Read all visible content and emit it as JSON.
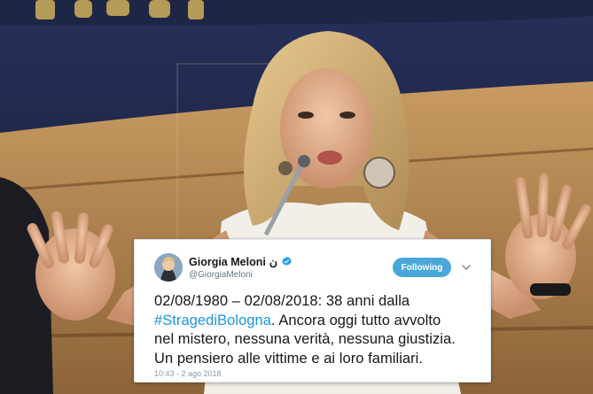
{
  "tweet": {
    "display_name": "Giorgia Meloni",
    "name_glyph": "ن",
    "handle": "@GiorgiaMeloni",
    "follow_label": "Following",
    "text": {
      "line1": "02/08/1980 – 02/08/2018: 38 anni dalla",
      "hashtag": "#StragediBologna",
      "line2_rest": ". Ancora oggi tutto avvolto",
      "line3": "nel mistero, nessuna verità, nessuna giustizia.",
      "line4": "Un pensiero alle vittime e ai loro familiari."
    },
    "timestamp": "10:43 - 2 ago 2018"
  },
  "colors": {
    "verified": "#1da1f2",
    "follow_button": "#4aa7d9",
    "hashtag": "#1b95e0",
    "wall_blue": "#1f2a4f",
    "desk_wood": "#b58a52"
  },
  "icons": {
    "verified": "verified-badge-icon",
    "chevron": "chevron-down-icon"
  }
}
